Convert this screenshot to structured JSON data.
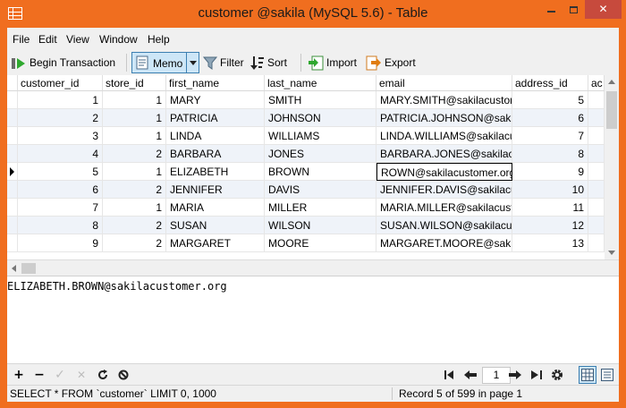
{
  "window": {
    "title": "customer @sakila (MySQL 5.6) - Table",
    "close_glyph": "✕"
  },
  "menu": [
    "File",
    "Edit",
    "View",
    "Window",
    "Help"
  ],
  "toolbar": {
    "begin_transaction": "Begin Transaction",
    "memo": "Memo",
    "filter": "Filter",
    "sort": "Sort",
    "import": "Import",
    "export": "Export"
  },
  "grid": {
    "columns": [
      "customer_id",
      "store_id",
      "first_name",
      "last_name",
      "email",
      "address_id",
      "ac"
    ],
    "rows": [
      [
        "1",
        "1",
        "MARY",
        "SMITH",
        "MARY.SMITH@sakilacustom",
        "5"
      ],
      [
        "2",
        "1",
        "PATRICIA",
        "JOHNSON",
        "PATRICIA.JOHNSON@sakila",
        "6"
      ],
      [
        "3",
        "1",
        "LINDA",
        "WILLIAMS",
        "LINDA.WILLIAMS@sakilacus",
        "7"
      ],
      [
        "4",
        "2",
        "BARBARA",
        "JONES",
        "BARBARA.JONES@sakilacus",
        "8"
      ],
      [
        "5",
        "1",
        "ELIZABETH",
        "BROWN",
        "ROWN@sakilacustomer.org",
        "9"
      ],
      [
        "6",
        "2",
        "JENNIFER",
        "DAVIS",
        "JENNIFER.DAVIS@sakilacust",
        "10"
      ],
      [
        "7",
        "1",
        "MARIA",
        "MILLER",
        "MARIA.MILLER@sakilacusto",
        "11"
      ],
      [
        "8",
        "2",
        "SUSAN",
        "WILSON",
        "SUSAN.WILSON@sakilacust",
        "12"
      ],
      [
        "9",
        "2",
        "MARGARET",
        "MOORE",
        "MARGARET.MOORE@sakila",
        "13"
      ]
    ],
    "selected_row": 4
  },
  "memo": {
    "text": "ELIZABETH.BROWN@sakilacustomer.org"
  },
  "navigation": {
    "add": "+",
    "delete": "−",
    "apply": "✓",
    "discard": "✕",
    "page": "1"
  },
  "status": {
    "sql": "SELECT * FROM `customer` LIMIT 0, 1000",
    "record": "Record 5 of 599 in page 1"
  },
  "colors": {
    "frame": "#f06e1f",
    "selection": "#cde6f7"
  }
}
